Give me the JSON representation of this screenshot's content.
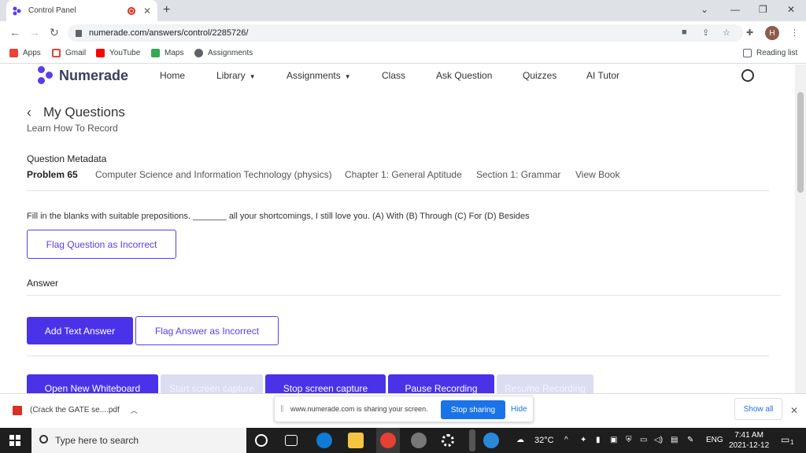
{
  "browser": {
    "tab_title": "Control Panel",
    "url": "numerade.com/answers/control/2285726/",
    "bookmarks": [
      "Apps",
      "Gmail",
      "YouTube",
      "Maps",
      "Assignments"
    ],
    "reading_list": "Reading list",
    "avatar_letter": "H"
  },
  "site": {
    "logo": "Numerade",
    "nav": [
      "Home",
      "Library",
      "Assignments",
      "Class",
      "Ask Question",
      "Quizzes",
      "AI Tutor"
    ]
  },
  "page": {
    "title": "My Questions",
    "subtitle": "Learn How To Record",
    "metadata_heading": "Question Metadata",
    "problem": "Problem 65",
    "subject": "Computer Science and Information Technology (physics)",
    "chapter": "Chapter 1: General Aptitude",
    "section": "Section 1: Grammar",
    "view_book": "View Book",
    "question": "Fill in the blanks with suitable prepositions. _______ all your shortcomings, I still love you. (A) With (B) Through (C) For (D) Besides",
    "flag_question": "Flag Question as Incorrect",
    "answer_heading": "Answer",
    "add_text_answer": "Add Text Answer",
    "flag_answer": "Flag Answer as Incorrect",
    "recording_buttons": [
      "Open New Whiteboard",
      "Start screen capture",
      "Stop screen capture",
      "Pause Recording",
      "Resume Recording"
    ]
  },
  "downloads": {
    "file": "(Crack the GATE se....pdf",
    "share_text": "www.numerade.com is sharing your screen.",
    "stop_sharing": "Stop sharing",
    "hide": "Hide",
    "show_all": "Show all"
  },
  "taskbar": {
    "search_placeholder": "Type here to search",
    "temperature": "32°C",
    "language": "ENG",
    "time": "7:41 AM",
    "date": "2021-12-12",
    "notification_count": "1"
  },
  "colors": {
    "brand": "#4a32e8",
    "chrome_blue": "#1a73e8"
  }
}
